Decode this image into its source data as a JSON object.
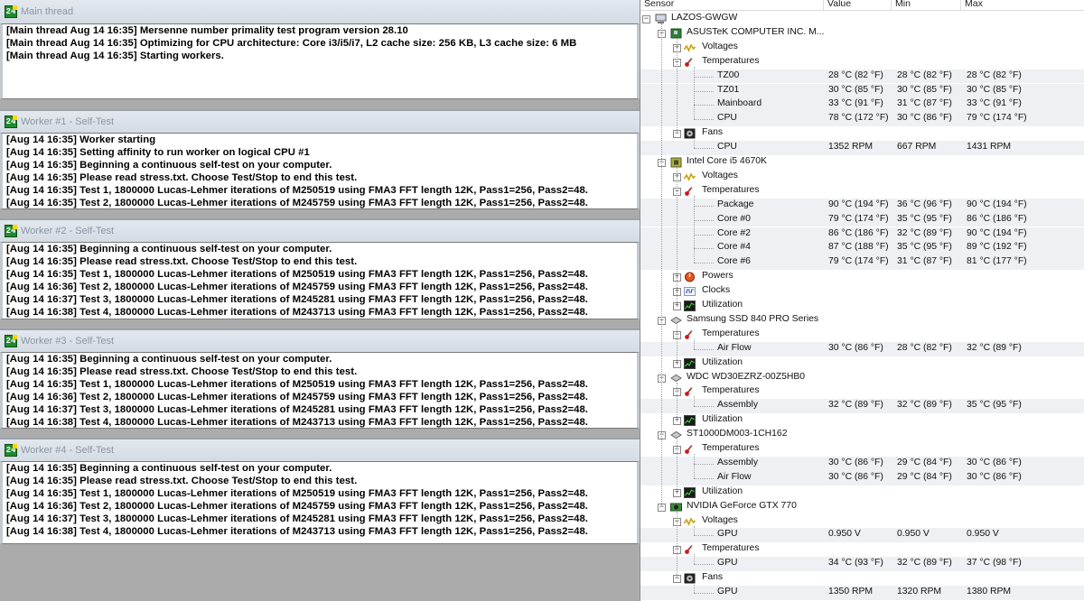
{
  "prime95": {
    "icon_text": "24",
    "main": {
      "title": "Main thread",
      "lines": [
        "[Main thread Aug 14 16:35] Mersenne number primality test program version 28.10",
        "[Main thread Aug 14 16:35] Optimizing for CPU architecture: Core i3/i5/i7, L2 cache size: 256 KB, L3 cache size: 6 MB",
        "[Main thread Aug 14 16:35] Starting workers."
      ]
    },
    "workers": [
      {
        "title": "Worker #1 - Self-Test",
        "lines": [
          "[Aug 14 16:35] Worker starting",
          "[Aug 14 16:35] Setting affinity to run worker on logical CPU #1",
          "[Aug 14 16:35] Beginning a continuous self-test on your computer.",
          "[Aug 14 16:35] Please read stress.txt.  Choose Test/Stop to end this test.",
          "[Aug 14 16:35] Test 1, 1800000 Lucas-Lehmer iterations of M250519 using FMA3 FFT length 12K, Pass1=256, Pass2=48.",
          "[Aug 14 16:35] Test 2, 1800000 Lucas-Lehmer iterations of M245759 using FMA3 FFT length 12K, Pass1=256, Pass2=48."
        ]
      },
      {
        "title": "Worker #2 - Self-Test",
        "lines": [
          "[Aug 14 16:35] Beginning a continuous self-test on your computer.",
          "[Aug 14 16:35] Please read stress.txt.  Choose Test/Stop to end this test.",
          "[Aug 14 16:35] Test 1, 1800000 Lucas-Lehmer iterations of M250519 using FMA3 FFT length 12K, Pass1=256, Pass2=48.",
          "[Aug 14 16:36] Test 2, 1800000 Lucas-Lehmer iterations of M245759 using FMA3 FFT length 12K, Pass1=256, Pass2=48.",
          "[Aug 14 16:37] Test 3, 1800000 Lucas-Lehmer iterations of M245281 using FMA3 FFT length 12K, Pass1=256, Pass2=48.",
          "[Aug 14 16:38] Test 4, 1800000 Lucas-Lehmer iterations of M243713 using FMA3 FFT length 12K, Pass1=256, Pass2=48."
        ]
      },
      {
        "title": "Worker #3 - Self-Test",
        "lines": [
          "[Aug 14 16:35] Beginning a continuous self-test on your computer.",
          "[Aug 14 16:35] Please read stress.txt.  Choose Test/Stop to end this test.",
          "[Aug 14 16:35] Test 1, 1800000 Lucas-Lehmer iterations of M250519 using FMA3 FFT length 12K, Pass1=256, Pass2=48.",
          "[Aug 14 16:36] Test 2, 1800000 Lucas-Lehmer iterations of M245759 using FMA3 FFT length 12K, Pass1=256, Pass2=48.",
          "[Aug 14 16:37] Test 3, 1800000 Lucas-Lehmer iterations of M245281 using FMA3 FFT length 12K, Pass1=256, Pass2=48.",
          "[Aug 14 16:38] Test 4, 1800000 Lucas-Lehmer iterations of M243713 using FMA3 FFT length 12K, Pass1=256, Pass2=48."
        ]
      },
      {
        "title": "Worker #4 - Self-Test",
        "lines": [
          "[Aug 14 16:35] Beginning a continuous self-test on your computer.",
          "[Aug 14 16:35] Please read stress.txt.  Choose Test/Stop to end this test.",
          "[Aug 14 16:35] Test 1, 1800000 Lucas-Lehmer iterations of M250519 using FMA3 FFT length 12K, Pass1=256, Pass2=48.",
          "[Aug 14 16:36] Test 2, 1800000 Lucas-Lehmer iterations of M245759 using FMA3 FFT length 12K, Pass1=256, Pass2=48.",
          "[Aug 14 16:37] Test 3, 1800000 Lucas-Lehmer iterations of M245281 using FMA3 FFT length 12K, Pass1=256, Pass2=48.",
          "[Aug 14 16:38] Test 4, 1800000 Lucas-Lehmer iterations of M243713 using FMA3 FFT length 12K, Pass1=256, Pass2=48."
        ]
      }
    ]
  },
  "hwinfo": {
    "columns": {
      "sensor": "Sensor",
      "value": "Value",
      "min": "Min",
      "max": "Max"
    },
    "rows": [
      {
        "level": 0,
        "toggle": "-",
        "icon": "computer-icon",
        "label": "LAZOS-GWGW"
      },
      {
        "level": 1,
        "toggle": "-",
        "icon": "motherboard-icon",
        "label": "ASUSTeK COMPUTER INC. M..."
      },
      {
        "level": 2,
        "toggle": "+",
        "icon": "voltage-icon",
        "label": "Voltages"
      },
      {
        "level": 2,
        "toggle": "-",
        "icon": "thermometer-icon",
        "label": "Temperatures"
      },
      {
        "level": 3,
        "label": "TZ00",
        "value": "28 °C  (82 °F)",
        "min": "28 °C  (82 °F)",
        "max": "28 °C  (82 °F)"
      },
      {
        "level": 3,
        "label": "TZ01",
        "value": "30 °C  (85 °F)",
        "min": "30 °C  (85 °F)",
        "max": "30 °C  (85 °F)"
      },
      {
        "level": 3,
        "label": "Mainboard",
        "value": "33 °C  (91 °F)",
        "min": "31 °C  (87 °F)",
        "max": "33 °C  (91 °F)"
      },
      {
        "level": 3,
        "label": "CPU",
        "value": "78 °C  (172 °F)",
        "min": "30 °C  (86 °F)",
        "max": "79 °C  (174 °F)"
      },
      {
        "level": 2,
        "toggle": "-",
        "icon": "fan-icon",
        "label": "Fans"
      },
      {
        "level": 3,
        "label": "CPU",
        "value": "1352 RPM",
        "min": "667 RPM",
        "max": "1431 RPM"
      },
      {
        "level": 1,
        "toggle": "-",
        "icon": "cpu-chip-icon",
        "label": "Intel Core i5 4670K"
      },
      {
        "level": 2,
        "toggle": "+",
        "icon": "voltage-icon",
        "label": "Voltages"
      },
      {
        "level": 2,
        "toggle": "-",
        "icon": "thermometer-icon",
        "label": "Temperatures"
      },
      {
        "level": 3,
        "label": "Package",
        "value": "90 °C  (194 °F)",
        "min": "36 °C  (96 °F)",
        "max": "90 °C  (194 °F)"
      },
      {
        "level": 3,
        "label": "Core #0",
        "value": "79 °C  (174 °F)",
        "min": "35 °C  (95 °F)",
        "max": "86 °C  (186 °F)"
      },
      {
        "level": 3,
        "label": "Core #2",
        "value": "86 °C  (186 °F)",
        "min": "32 °C  (89 °F)",
        "max": "90 °C  (194 °F)"
      },
      {
        "level": 3,
        "label": "Core #4",
        "value": "87 °C  (188 °F)",
        "min": "35 °C  (95 °F)",
        "max": "89 °C  (192 °F)"
      },
      {
        "level": 3,
        "label": "Core #6",
        "value": "79 °C  (174 °F)",
        "min": "31 °C  (87 °F)",
        "max": "81 °C  (177 °F)"
      },
      {
        "level": 2,
        "toggle": "+",
        "icon": "power-icon",
        "label": "Powers"
      },
      {
        "level": 2,
        "toggle": "+",
        "icon": "clock-icon",
        "label": "Clocks"
      },
      {
        "level": 2,
        "toggle": "+",
        "icon": "utilization-icon",
        "label": "Utilization"
      },
      {
        "level": 1,
        "toggle": "-",
        "icon": "drive-icon",
        "label": "Samsung SSD 840 PRO Series"
      },
      {
        "level": 2,
        "toggle": "-",
        "icon": "thermometer-icon",
        "label": "Temperatures"
      },
      {
        "level": 3,
        "label": "Air Flow",
        "value": "30 °C  (86 °F)",
        "min": "28 °C  (82 °F)",
        "max": "32 °C  (89 °F)"
      },
      {
        "level": 2,
        "toggle": "+",
        "icon": "utilization-icon",
        "label": "Utilization"
      },
      {
        "level": 1,
        "toggle": "-",
        "icon": "drive-icon",
        "label": "WDC WD30EZRZ-00Z5HB0"
      },
      {
        "level": 2,
        "toggle": "-",
        "icon": "thermometer-icon",
        "label": "Temperatures"
      },
      {
        "level": 3,
        "label": "Assembly",
        "value": "32 °C  (89 °F)",
        "min": "32 °C  (89 °F)",
        "max": "35 °C  (95 °F)"
      },
      {
        "level": 2,
        "toggle": "+",
        "icon": "utilization-icon",
        "label": "Utilization"
      },
      {
        "level": 1,
        "toggle": "-",
        "icon": "drive-icon",
        "label": "ST1000DM003-1CH162"
      },
      {
        "level": 2,
        "toggle": "-",
        "icon": "thermometer-icon",
        "label": "Temperatures"
      },
      {
        "level": 3,
        "label": "Assembly",
        "value": "30 °C  (86 °F)",
        "min": "29 °C  (84 °F)",
        "max": "30 °C  (86 °F)"
      },
      {
        "level": 3,
        "label": "Air Flow",
        "value": "30 °C  (86 °F)",
        "min": "29 °C  (84 °F)",
        "max": "30 °C  (86 °F)"
      },
      {
        "level": 2,
        "toggle": "+",
        "icon": "utilization-icon",
        "label": "Utilization"
      },
      {
        "level": 1,
        "toggle": "-",
        "icon": "gpu-icon",
        "label": "NVIDIA GeForce GTX 770"
      },
      {
        "level": 2,
        "toggle": "-",
        "icon": "voltage-icon",
        "label": "Voltages"
      },
      {
        "level": 3,
        "label": "GPU",
        "value": "0.950 V",
        "min": "0.950 V",
        "max": "0.950 V"
      },
      {
        "level": 2,
        "toggle": "-",
        "icon": "thermometer-icon",
        "label": "Temperatures"
      },
      {
        "level": 3,
        "label": "GPU",
        "value": "34 °C  (93 °F)",
        "min": "32 °C  (89 °F)",
        "max": "37 °C  (98 °F)"
      },
      {
        "level": 2,
        "toggle": "-",
        "icon": "fan-icon",
        "label": "Fans"
      },
      {
        "level": 3,
        "label": "GPU",
        "value": "1350 RPM",
        "min": "1320 RPM",
        "max": "1380 RPM"
      }
    ]
  }
}
